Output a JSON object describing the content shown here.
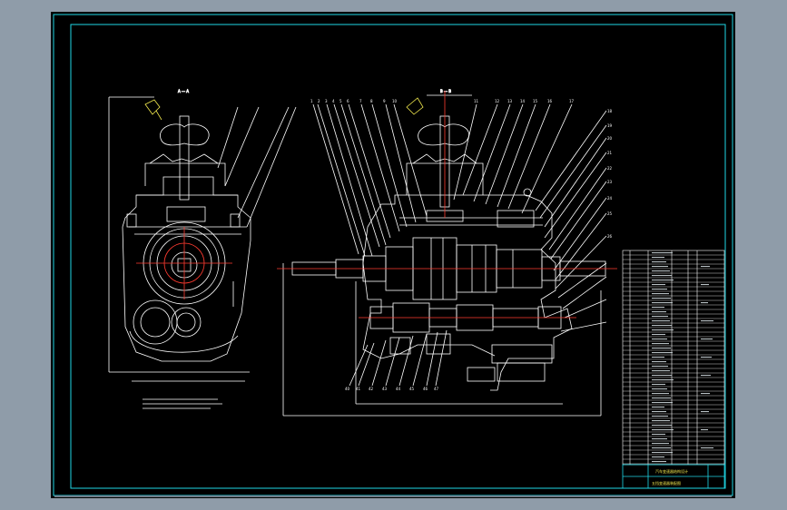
{
  "drawing": {
    "left_view": {
      "section_label": "A — A"
    },
    "right_view": {
      "section_label": "B — B"
    },
    "leader_numbers_top": [
      "1",
      "2",
      "3",
      "4",
      "5",
      "6",
      "7",
      "8",
      "9",
      "10",
      "11",
      "12",
      "13",
      "14",
      "15",
      "16",
      "17",
      "18",
      "19",
      "20",
      "21",
      "22",
      "23",
      "24",
      "25",
      "26"
    ],
    "leader_numbers_bottom": [
      "40",
      "41",
      "42",
      "43",
      "44",
      "45",
      "46",
      "47",
      "48",
      "49",
      "50"
    ],
    "title_block": {
      "title_line_1": "汽车变速器结构设计",
      "title_line_2": "五挡变速器装配图"
    }
  },
  "colors": {
    "background": "#8f9ca9",
    "sheet": "#000000",
    "frame": "#1fd7e6",
    "lines": "#ffffff",
    "accent_red": "#ff3b30",
    "accent_yellow": "#f2e94e"
  }
}
